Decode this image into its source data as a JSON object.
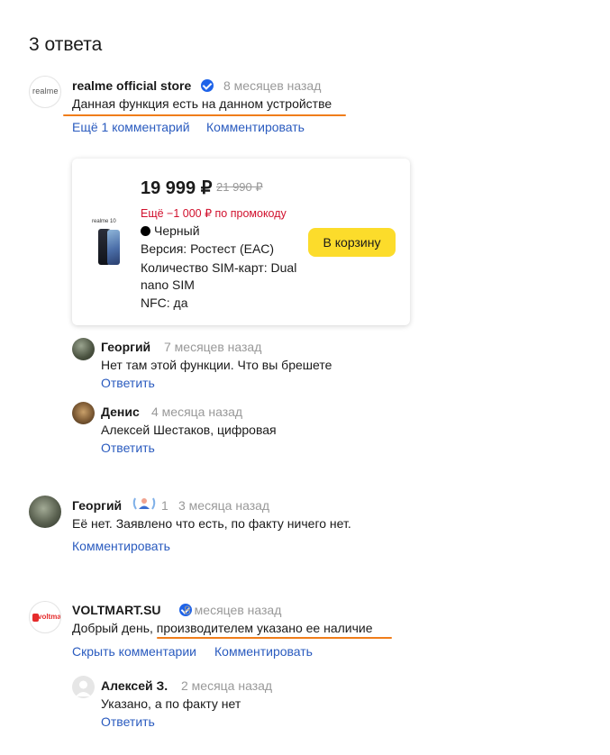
{
  "header": {
    "title": "3 ответа"
  },
  "answers": [
    {
      "author": "realme official store",
      "time": "8 месяцев назад",
      "text": "Данная функция есть на данном устройстве",
      "more_comments": "Ещё 1 комментарий",
      "comment_link": "Комментировать",
      "avatar_text": "realme",
      "product": {
        "price": "19 999 ₽",
        "old_price": "21 990 ₽",
        "promo": "Ещё −1 000 ₽ по промокоду",
        "color": "Черный",
        "version": "Версия: Ростест (EAC)",
        "sim_line1": "Количество SIM-карт: Dual",
        "sim_line2": "nano SIM",
        "nfc": "NFC: да",
        "cart_button": "В корзину",
        "image_label": "realme 10"
      },
      "replies": [
        {
          "author": "Георгий",
          "time": "7 месяцев назад",
          "text": "Нет там этой функции. Что вы брешете",
          "reply_link": "Ответить"
        },
        {
          "author": "Денис",
          "time": "4 месяца назад",
          "text": "Алексей Шестаков, цифровая",
          "reply_link": "Ответить"
        }
      ]
    },
    {
      "author": "Георгий",
      "badge_count": "1",
      "time": "3 месяца назад",
      "text": "Её нет. Заявлено что есть, по факту ничего нет.",
      "comment_link": "Комментировать"
    },
    {
      "author": "VOLTMART.SU",
      "time": "8 месяцев назад",
      "text": "Добрый день, производителем указано ее наличие",
      "hide_comments": "Скрыть комментарии",
      "comment_link": "Комментировать",
      "avatar_text": "voltmart",
      "replies": [
        {
          "author": "Алексей З.",
          "time": "2 месяца назад",
          "text": "Указано, а по факту нет",
          "reply_link": "Ответить"
        }
      ]
    }
  ],
  "colors": {
    "link": "#2a5bbf",
    "accent_underline": "#f07d1a",
    "cart_button": "#fcdc2b",
    "promo": "#d1102d",
    "verified": "#1e63e9"
  }
}
